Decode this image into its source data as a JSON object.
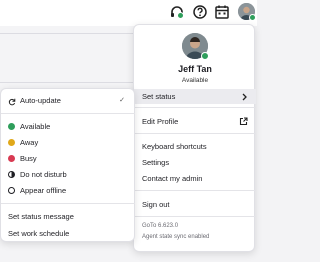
{
  "header": {
    "icons": [
      "headset-icon",
      "help-icon",
      "calendar-icon",
      "avatar"
    ],
    "presence_color": "#2e9e5b"
  },
  "profile": {
    "name": "Jeff Tan",
    "state": "Available",
    "menu": {
      "set_status": "Set status",
      "edit_profile": "Edit Profile",
      "keyboard_shortcuts": "Keyboard shortcuts",
      "settings": "Settings",
      "contact_admin": "Contact my admin",
      "sign_out": "Sign out"
    },
    "version": "GoTo 6.623.0",
    "sync_status": "Agent state sync enabled"
  },
  "status_menu": {
    "auto_update": "Auto-update",
    "auto_update_checked": "✓",
    "options": [
      {
        "label": "Available",
        "color": "#2e9e5b"
      },
      {
        "label": "Away",
        "color": "#e0a81a"
      },
      {
        "label": "Busy",
        "color": "#d83a52"
      },
      {
        "label": "Do not disturb",
        "color": "#1f1f24"
      },
      {
        "label": "Appear offline",
        "color": "#ffffff"
      }
    ],
    "set_status_message": "Set status message",
    "set_work_schedule": "Set work schedule"
  }
}
